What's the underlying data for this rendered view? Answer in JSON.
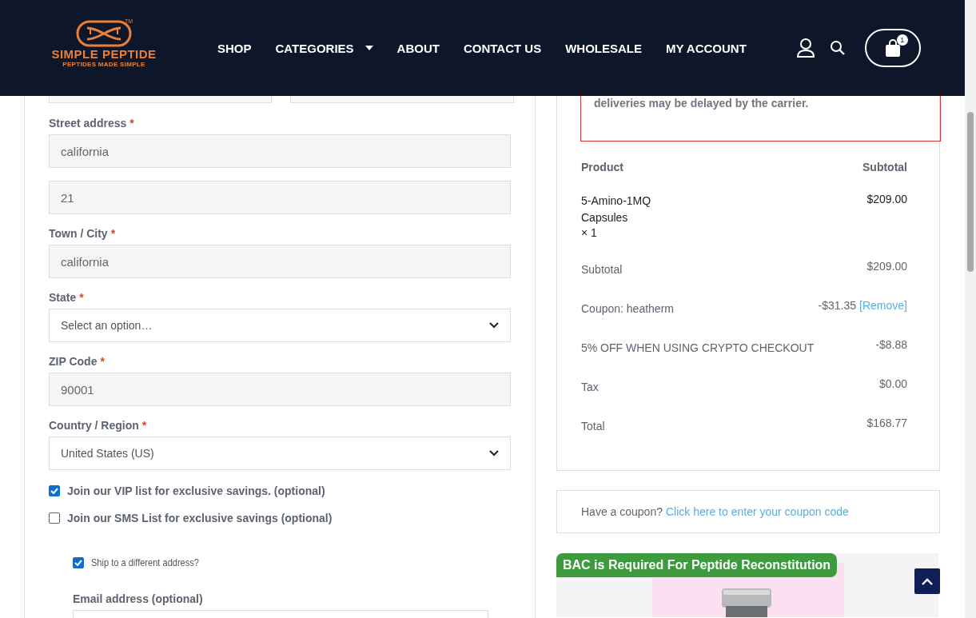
{
  "header": {
    "logo": {
      "name": "SIMPLE PEPTIDE",
      "tagline": "PEPTIDES MADE SIMPLE",
      "trademark": "TM"
    },
    "nav": [
      {
        "label": "SHOP",
        "dropdown": false
      },
      {
        "label": "CATEGORIES",
        "dropdown": true
      },
      {
        "label": "ABOUT",
        "dropdown": false
      },
      {
        "label": "CONTACT US",
        "dropdown": false
      },
      {
        "label": "WHOLESALE",
        "dropdown": false
      },
      {
        "label": "MY ACCOUNT",
        "dropdown": false
      }
    ],
    "cart_count": "1"
  },
  "form": {
    "fields": [
      {
        "kind": "text",
        "label": "Street address",
        "required_mark": "*",
        "value": "california"
      },
      {
        "kind": "text",
        "value": "21"
      },
      {
        "kind": "text",
        "label": "Town / City",
        "required_mark": "*",
        "value": "california"
      },
      {
        "kind": "select",
        "label": "State",
        "required_mark": "*",
        "value": "Select an option…"
      },
      {
        "kind": "text",
        "label": "ZIP Code",
        "required_mark": "*",
        "value": "90001"
      },
      {
        "kind": "select",
        "label": "Country / Region",
        "required_mark": "*",
        "value": "United States (US)"
      }
    ],
    "checkboxes": [
      {
        "label": "Join our VIP list for exclusive savings. (optional)",
        "checked": true
      },
      {
        "label": "Join our SMS List for exclusive savings (optional)",
        "checked": false
      }
    ],
    "ship_different": {
      "label": "Ship to a different address?",
      "checked": true
    },
    "email_label": "Email address (optional)"
  },
  "order": {
    "notice": "deliveries may be delayed by the carrier.",
    "columns": [
      "Product",
      "Subtotal"
    ],
    "item": {
      "name": "5-Amino-1MQ Capsules",
      "qty": "× 1",
      "price": "$209.00"
    },
    "rows": [
      {
        "label": "Subtotal",
        "value": "$209.00"
      },
      {
        "label": "Coupon: heatherm",
        "value": "-$31.35",
        "link": "[Remove]"
      },
      {
        "label": "5% OFF WHEN USING CRYPTO CHECKOUT",
        "value": "-$8.88"
      },
      {
        "label": "Tax",
        "value": "$0.00"
      },
      {
        "label": "Total",
        "value": "$168.77"
      }
    ]
  },
  "coupon": {
    "prompt": "Have a coupon?",
    "link": "Click here to enter your coupon code"
  },
  "banner": {
    "label": "BAC is Required For Peptide Reconstitution"
  }
}
